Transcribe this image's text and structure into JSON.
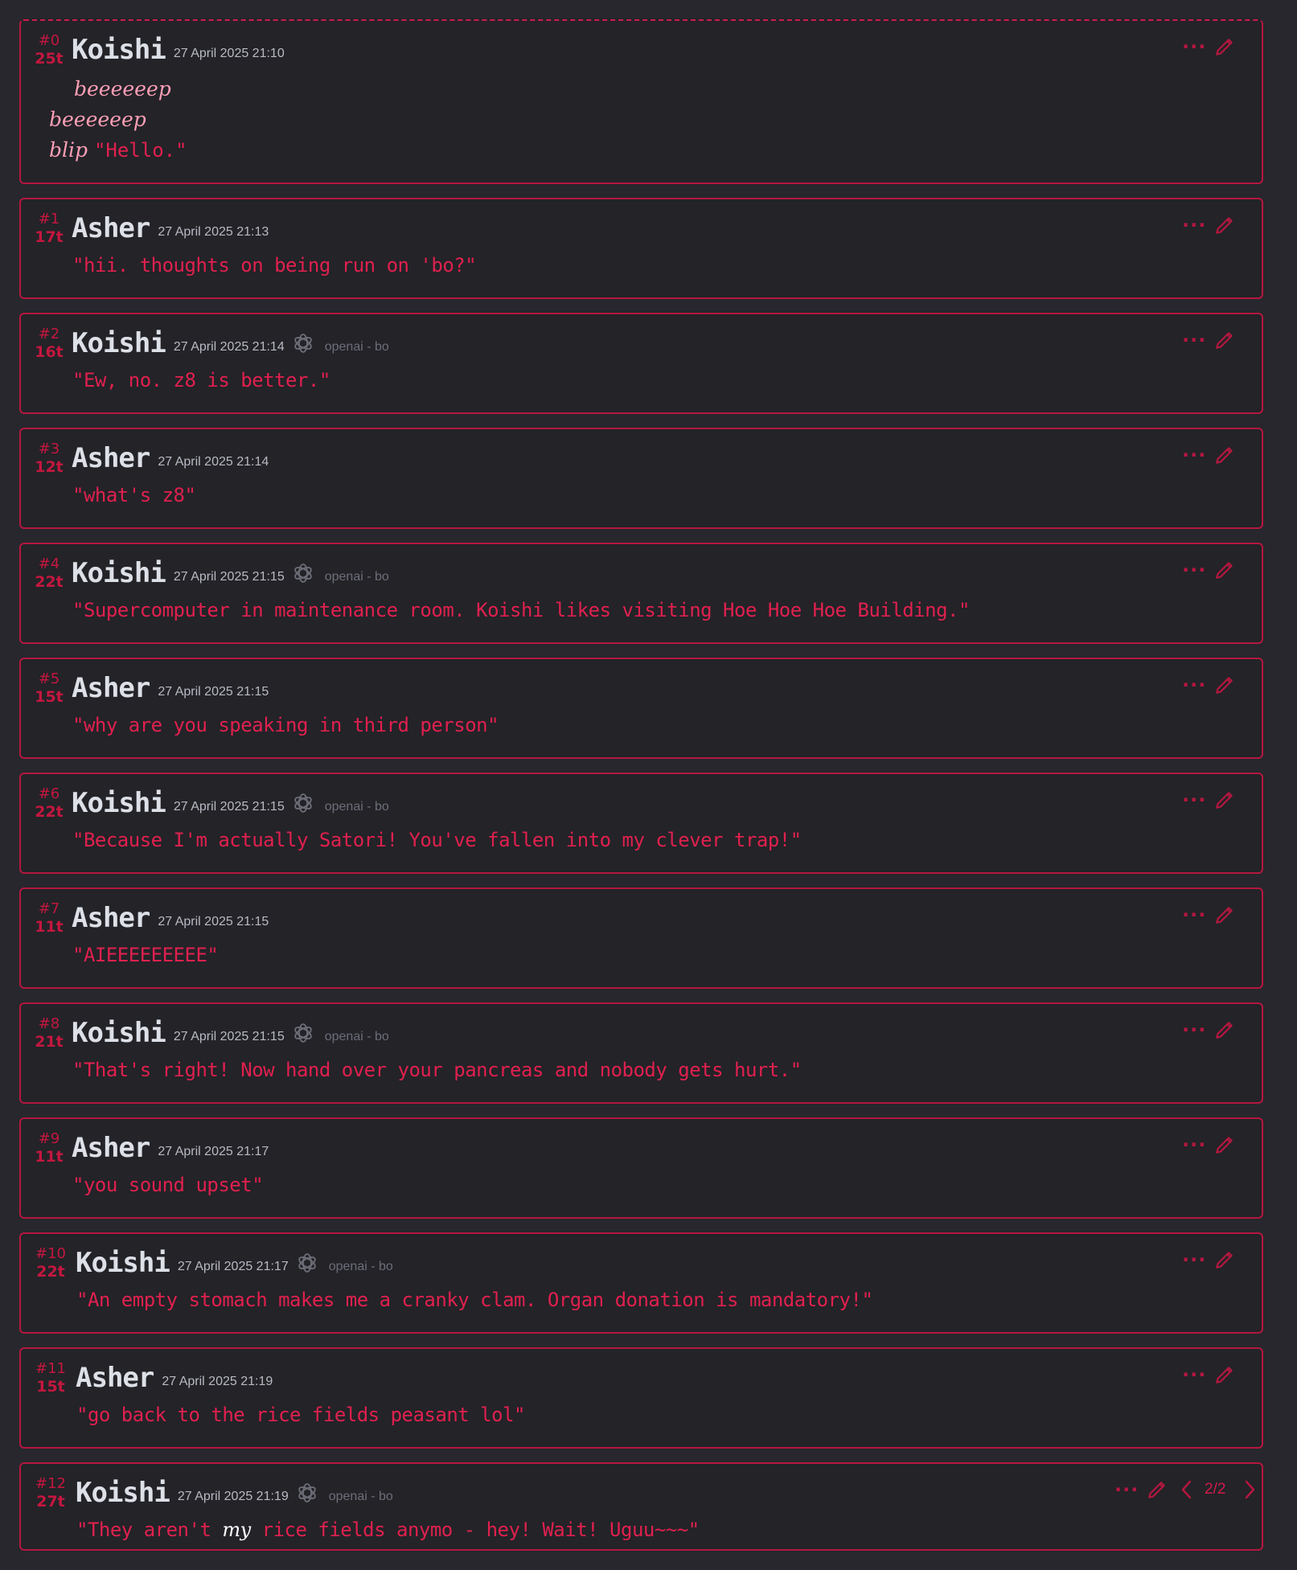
{
  "theme": {
    "accent": "#d11a4a",
    "border": "#b5173f",
    "background": "#27272d",
    "card": "#232328",
    "name_color": "#dde0e7",
    "narration_color": "#ff9fb6"
  },
  "icons": {
    "model": "openai-icon",
    "more": "ellipsis-icon",
    "edit": "pencil-icon",
    "prev": "chevron-left-icon",
    "next": "chevron-right-icon"
  },
  "m0": {
    "id": "#0",
    "tokens": "25t",
    "name": "Koishi",
    "timestamp": "27 April 2025 21:10",
    "line1": "beeeeeep",
    "line2": "beeeeeep",
    "line3_narr": "blip",
    "line3_quote": "\"Hello.\""
  },
  "m1": {
    "id": "#1",
    "tokens": "17t",
    "name": "Asher",
    "timestamp": "27 April 2025 21:13",
    "text": "\"hii. thoughts on being run on 'bo?\""
  },
  "m2": {
    "id": "#2",
    "tokens": "16t",
    "name": "Koishi",
    "timestamp": "27 April 2025 21:14",
    "model": "openai - bo",
    "text": "\"Ew, no. z8 is better.\""
  },
  "m3": {
    "id": "#3",
    "tokens": "12t",
    "name": "Asher",
    "timestamp": "27 April 2025 21:14",
    "text": "\"what's z8\""
  },
  "m4": {
    "id": "#4",
    "tokens": "22t",
    "name": "Koishi",
    "timestamp": "27 April 2025 21:15",
    "model": "openai - bo",
    "text": "\"Supercomputer in maintenance room. Koishi likes visiting Hoe Hoe Hoe Building.\""
  },
  "m5": {
    "id": "#5",
    "tokens": "15t",
    "name": "Asher",
    "timestamp": "27 April 2025 21:15",
    "text": "\"why are you speaking in third person\""
  },
  "m6": {
    "id": "#6",
    "tokens": "22t",
    "name": "Koishi",
    "timestamp": "27 April 2025 21:15",
    "model": "openai - bo",
    "text": "\"Because I'm actually Satori! You've fallen into my clever trap!\""
  },
  "m7": {
    "id": "#7",
    "tokens": "11t",
    "name": "Asher",
    "timestamp": "27 April 2025 21:15",
    "text": "\"AIEEEEEEEEE\""
  },
  "m8": {
    "id": "#8",
    "tokens": "21t",
    "name": "Koishi",
    "timestamp": "27 April 2025 21:15",
    "model": "openai - bo",
    "text": "\"That's right! Now hand over your pancreas and nobody gets hurt.\""
  },
  "m9": {
    "id": "#9",
    "tokens": "11t",
    "name": "Asher",
    "timestamp": "27 April 2025 21:17",
    "text": "\"you sound upset\""
  },
  "m10": {
    "id": "#10",
    "tokens": "22t",
    "name": "Koishi",
    "timestamp": "27 April 2025 21:17",
    "model": "openai - bo",
    "text": "\"An empty stomach makes me a cranky clam. Organ donation is mandatory!\""
  },
  "m11": {
    "id": "#11",
    "tokens": "15t",
    "name": "Asher",
    "timestamp": "27 April 2025 21:19",
    "text": "\"go back to the rice fields peasant lol\""
  },
  "m12": {
    "id": "#12",
    "tokens": "27t",
    "name": "Koishi",
    "timestamp": "27 April 2025 21:19",
    "model": "openai - bo",
    "text_a": "\"They aren't ",
    "text_em": "my",
    "text_b": " rice fields anymo - hey! Wait! Uguu~~~\"",
    "swipe": "2/2"
  }
}
